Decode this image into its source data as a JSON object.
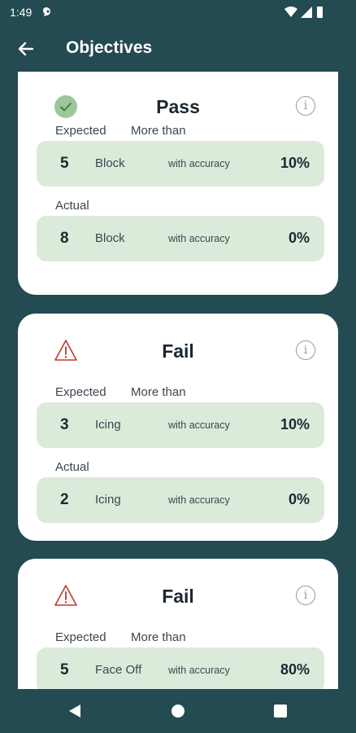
{
  "status_bar": {
    "time": "1:49"
  },
  "app_bar": {
    "title": "Objectives"
  },
  "labels": {
    "expected": "Expected",
    "actual": "Actual",
    "with_accuracy": "with accuracy"
  },
  "objectives": [
    {
      "status": "Pass",
      "comparison": "More than",
      "expected": {
        "count": "5",
        "action": "Block",
        "accuracy": "10%"
      },
      "actual": {
        "count": "8",
        "action": "Block",
        "accuracy": "0%"
      }
    },
    {
      "status": "Fail",
      "comparison": "More than",
      "expected": {
        "count": "3",
        "action": "Icing",
        "accuracy": "10%"
      },
      "actual": {
        "count": "2",
        "action": "Icing",
        "accuracy": "0%"
      }
    },
    {
      "status": "Fail",
      "comparison": "More than",
      "expected": {
        "count": "5",
        "action": "Face Off",
        "accuracy": "80%"
      }
    }
  ],
  "colors": {
    "background": "#244a52",
    "card": "#ffffff",
    "row": "#dcebd9",
    "pass": "#9cc79a",
    "fail": "#c0392b"
  },
  "icons": {
    "back": "arrow-left-icon",
    "pass": "check-circle-icon",
    "fail": "warning-triangle-icon",
    "info": "info-icon"
  }
}
